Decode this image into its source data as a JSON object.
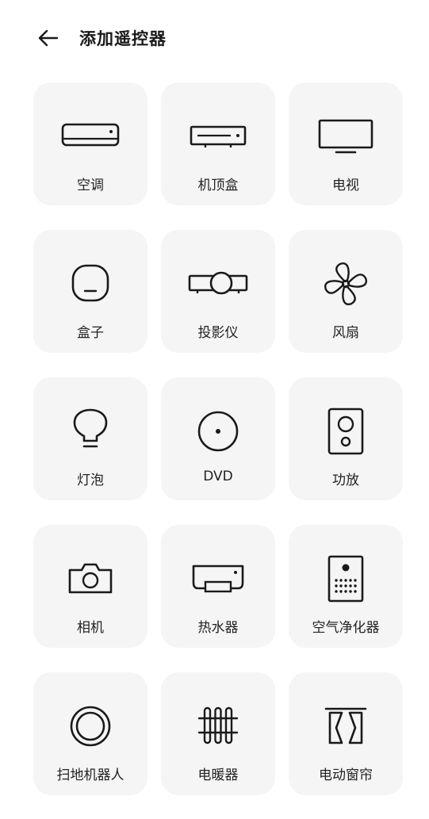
{
  "header": {
    "title": "添加遥控器",
    "back_icon": "arrow-left-icon"
  },
  "devices": [
    {
      "label": "空调",
      "icon": "air-conditioner-icon"
    },
    {
      "label": "机顶盒",
      "icon": "set-top-box-icon"
    },
    {
      "label": "电视",
      "icon": "tv-icon"
    },
    {
      "label": "盒子",
      "icon": "box-icon"
    },
    {
      "label": "投影仪",
      "icon": "projector-icon"
    },
    {
      "label": "风扇",
      "icon": "fan-icon"
    },
    {
      "label": "灯泡",
      "icon": "bulb-icon"
    },
    {
      "label": "DVD",
      "icon": "dvd-icon"
    },
    {
      "label": "功放",
      "icon": "speaker-icon"
    },
    {
      "label": "相机",
      "icon": "camera-icon"
    },
    {
      "label": "热水器",
      "icon": "water-heater-icon"
    },
    {
      "label": "空气净化器",
      "icon": "air-purifier-icon"
    },
    {
      "label": "扫地机器人",
      "icon": "robot-vacuum-icon"
    },
    {
      "label": "电暖器",
      "icon": "heater-icon"
    },
    {
      "label": "电动窗帘",
      "icon": "curtain-icon"
    }
  ]
}
